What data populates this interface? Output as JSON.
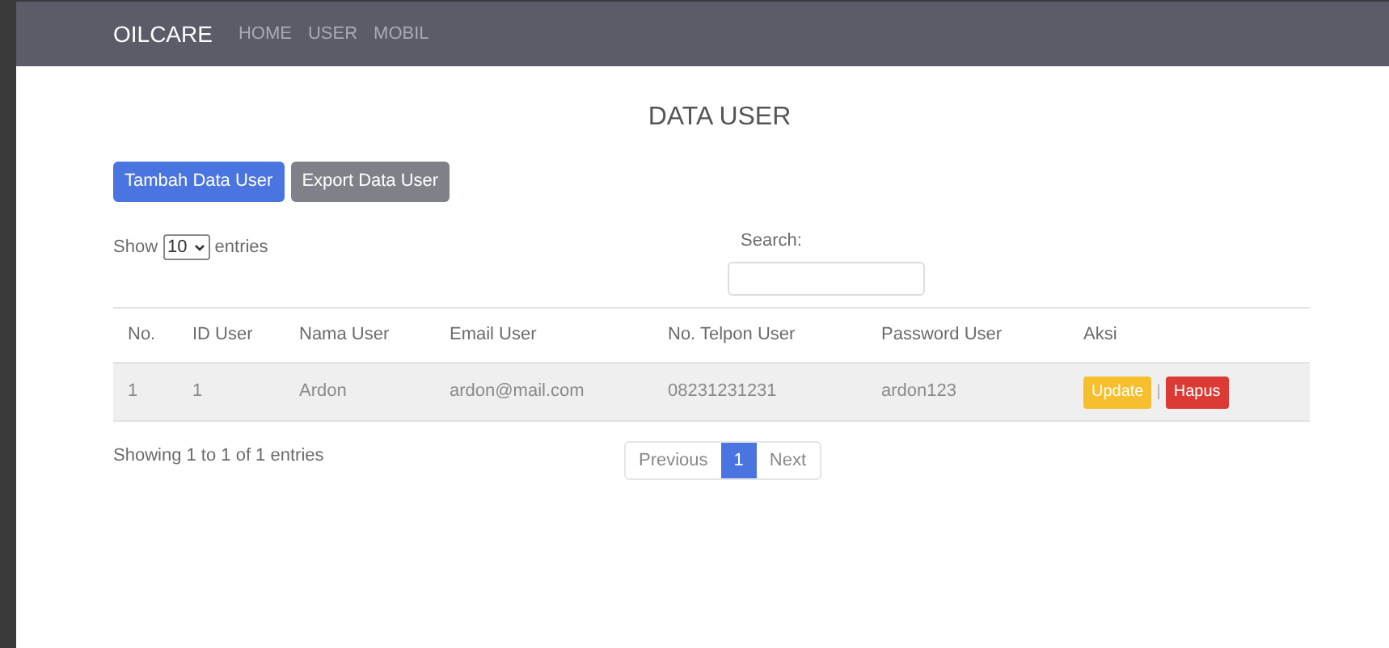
{
  "navbar": {
    "brand": "OILCARE",
    "links": [
      "HOME",
      "USER",
      "MOBIL"
    ]
  },
  "title": "DATA USER",
  "buttons": [
    {
      "label": "Tambah Data User",
      "kind": "primary"
    },
    {
      "label": "Export Data User",
      "kind": "secondary"
    }
  ],
  "length": {
    "before": "Show",
    "value": "10",
    "after": "entries"
  },
  "search": {
    "label": "Search:"
  },
  "table": {
    "columns": [
      "No.",
      "ID User",
      "Nama User",
      "Email User",
      "No. Telpon User",
      "Password User",
      "Aksi"
    ],
    "rows": [
      {
        "cells": [
          "1",
          "1",
          "Ardon",
          "ardon@mail.com",
          "08231231231",
          "ardon123"
        ],
        "actions": [
          {
            "label": "Update",
            "kind": "update"
          },
          {
            "label": "Hapus",
            "kind": "delete"
          }
        ],
        "separator": "|"
      }
    ]
  },
  "info": "Showing 1 to 1 of 1 entries",
  "pagination": [
    {
      "label": "Previous",
      "selected": false
    },
    {
      "label": "1",
      "selected": true
    },
    {
      "label": "Next",
      "selected": false
    }
  ]
}
